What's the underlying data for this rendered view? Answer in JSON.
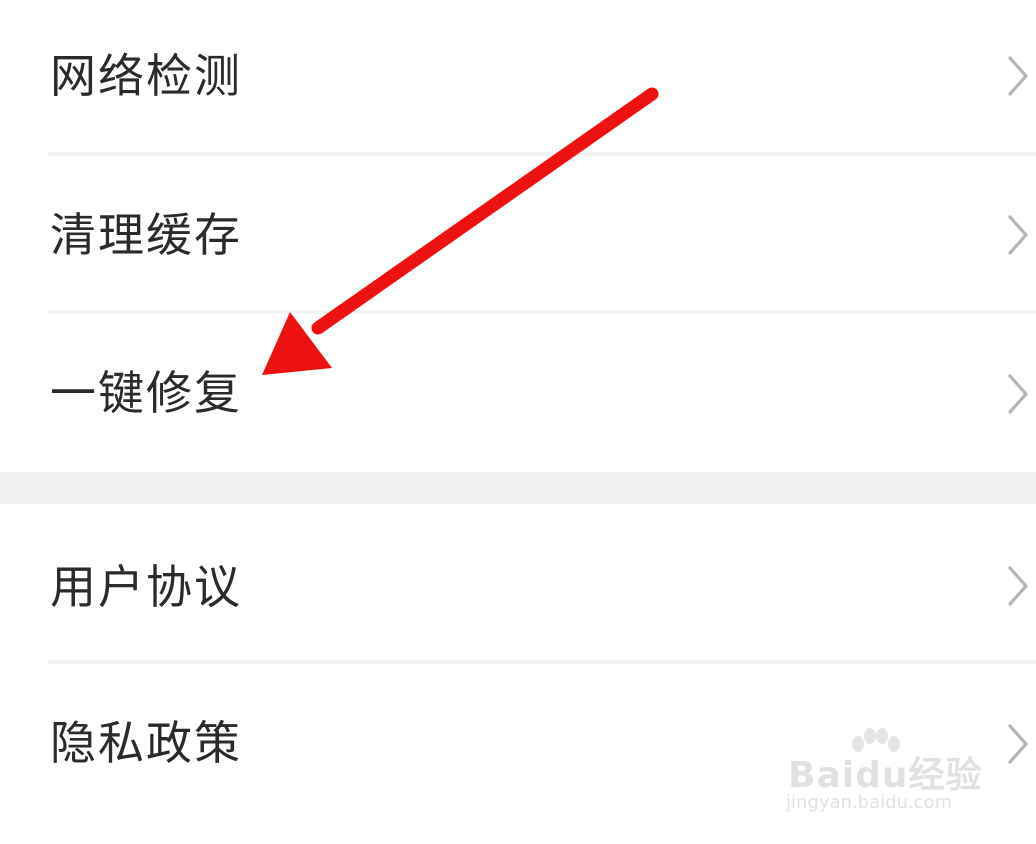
{
  "settings_list": {
    "group1": [
      {
        "label": "网络检测"
      },
      {
        "label": "清理缓存"
      },
      {
        "label": "一键修复"
      }
    ],
    "group2": [
      {
        "label": "用户协议"
      },
      {
        "label": "隐私政策"
      }
    ]
  },
  "chevron_icon": "chevron-right-icon",
  "annotation": {
    "type": "arrow",
    "color": "#ee1111",
    "points_to": "一键修复"
  },
  "watermark": {
    "logo": "Baidu经验",
    "url": "jingyan.baidu.com"
  }
}
